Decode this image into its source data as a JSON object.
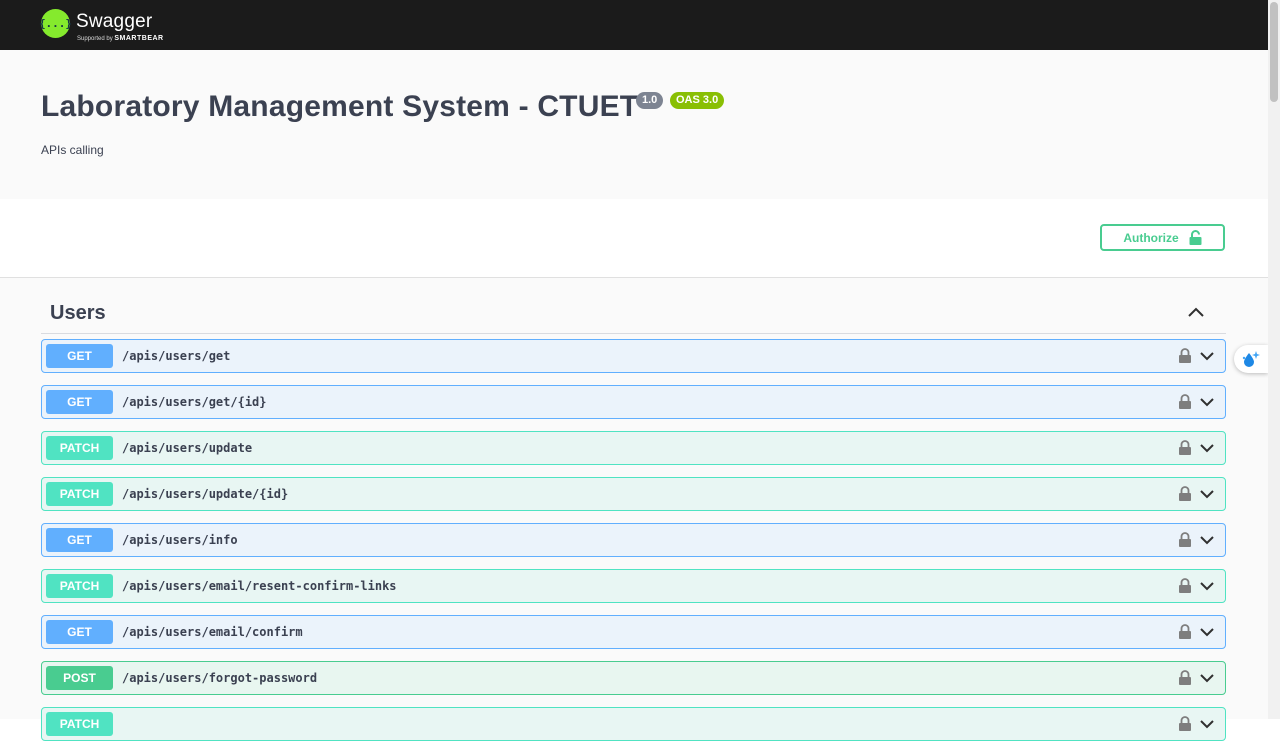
{
  "topbar": {
    "logo_glyph": "{...}",
    "logo_name": "Swagger",
    "logo_sub_prefix": "Supported by",
    "logo_sub_brand": "SMARTBEAR",
    "logo_color": "#85ea2d"
  },
  "info": {
    "title": "Laboratory Management System - CTUET",
    "version": "1.0",
    "oas": "OAS 3.0",
    "description": "APIs calling"
  },
  "authorize": {
    "label": "Authorize",
    "icon": "unlock-icon",
    "color": "#49cc90"
  },
  "tag": {
    "name": "Users",
    "toggle_icon": "chevron-up-icon"
  },
  "colors": {
    "get": "#61affe",
    "patch": "#50e3c2",
    "post": "#49cc90"
  },
  "operations": [
    {
      "method": "GET",
      "path": "/apis/users/get"
    },
    {
      "method": "GET",
      "path": "/apis/users/get/{id}"
    },
    {
      "method": "PATCH",
      "path": "/apis/users/update"
    },
    {
      "method": "PATCH",
      "path": "/apis/users/update/{id}"
    },
    {
      "method": "GET",
      "path": "/apis/users/info"
    },
    {
      "method": "PATCH",
      "path": "/apis/users/email/resent-confirm-links"
    },
    {
      "method": "GET",
      "path": "/apis/users/email/confirm"
    },
    {
      "method": "POST",
      "path": "/apis/users/forgot-password"
    },
    {
      "method": "PATCH",
      "path": ""
    }
  ]
}
